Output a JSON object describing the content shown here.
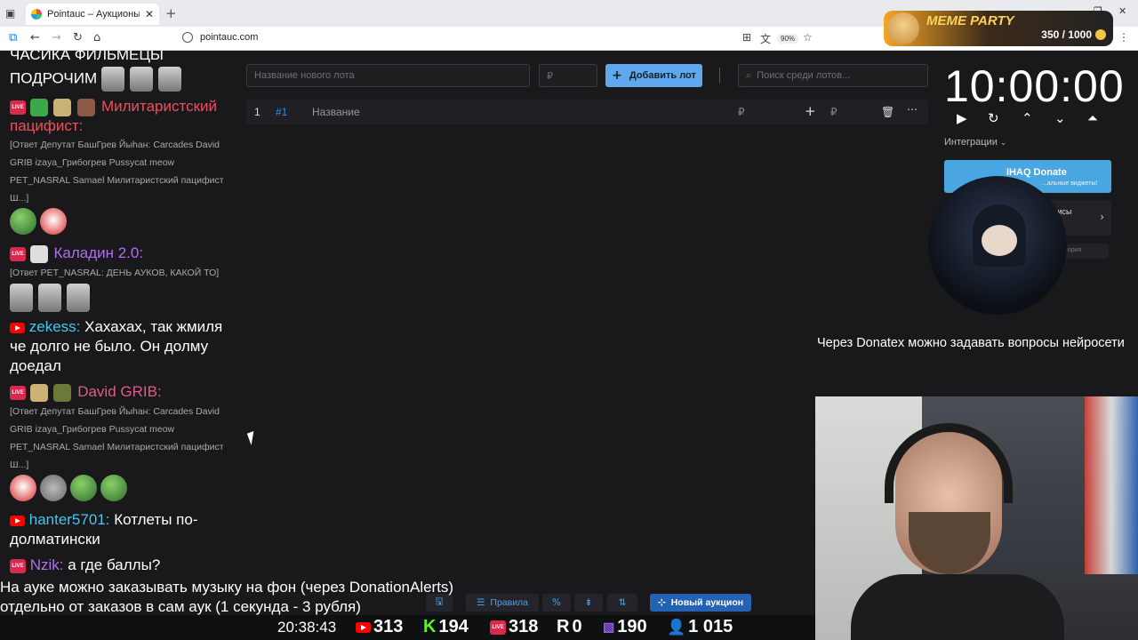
{
  "browser": {
    "tab_title": "Pointauc – Аукционы, лотереи",
    "url": "pointauc.com",
    "zoom": "90%"
  },
  "meme_party": {
    "title": "MEME PARTY",
    "progress": "350 / 1000"
  },
  "chat": [
    {
      "text": "ЧАСИКА ФИЛЬМЕЦЫ"
    },
    {
      "text": "ПОДРОЧИМ"
    },
    {
      "user": "Милитаристский пацифист:",
      "text": "[Ответ Депутат БашГрев Йыhан: Carcades David GRIB izaya_Грибогрев Pussycat meow PET_NASRAL Samael Милитаристский пацифист Ш...]"
    },
    {
      "user": "Каладин 2.0:",
      "text": "[Ответ PET_NASRAL: ДЕНЬ АУКОВ, КАКОЙ ТО]"
    },
    {
      "user": "zekess:",
      "text": "Хахахах, так жмиля че долго не было. Он долму доедал"
    },
    {
      "user": "David GRIB:",
      "text": "[Ответ Депутат БашГрев Йыhан: Carcades David GRIB izaya_Грибогрев Pussycat meow PET_NASRAL Samael Милитаристский пацифист Ш...]"
    },
    {
      "user": "hanter5701:",
      "text": "Котлеты по-долматински"
    },
    {
      "user": "Nzik:",
      "text": "а где баллы?"
    }
  ],
  "auction": {
    "new_lot_placeholder": "Название нового лота",
    "amount_placeholder": "₽",
    "add_lot_label": "Добавить лот",
    "search_placeholder": "Поиск среди лотов...",
    "lot": {
      "index": "1",
      "id": "#1",
      "name": "Название",
      "currency": "₽",
      "add_currency": "₽"
    }
  },
  "timer": {
    "value": "10:00:00",
    "integrations_label": "Интеграции",
    "ihaq_title": "IHAQ Donate",
    "ihaq_sub": "...альные виджеты!",
    "card2_label": "...исы",
    "card3_label": "...ория"
  },
  "notice": "Через Donatex можно задавать вопросы нейросети",
  "bottom_text": {
    "line1": "На ауке можно заказывать музыку на фон (через DonationAlerts)",
    "line2": "отдельно от заказов в сам аук (1 секунда - 3 рубля)"
  },
  "bottom_buttons": {
    "rules": "Правила",
    "new_auction": "Новый аукцион"
  },
  "stats": {
    "clock": "20:38:43",
    "youtube": "313",
    "kick": "194",
    "vk": "318",
    "r": "0",
    "twitch": "190",
    "viewers": "1 015"
  }
}
